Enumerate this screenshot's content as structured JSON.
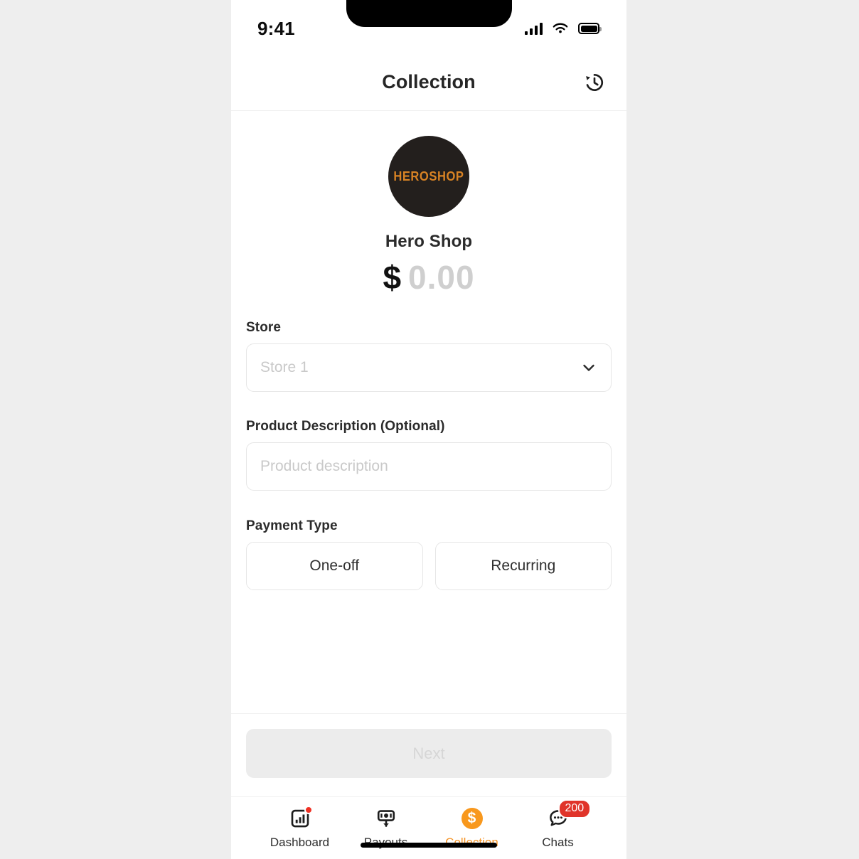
{
  "status_bar": {
    "time": "9:41",
    "icons": [
      "cellular-signal-icon",
      "wifi-icon",
      "battery-icon"
    ]
  },
  "header": {
    "title": "Collection",
    "history_icon": "history-icon"
  },
  "merchant": {
    "logo_text": "HEROSHOP",
    "name": "Hero Shop",
    "currency_symbol": "$",
    "amount_placeholder": "0.00"
  },
  "form": {
    "store": {
      "label": "Store",
      "placeholder": "Store 1",
      "value": "",
      "chevron_icon": "chevron-down-icon"
    },
    "description": {
      "label": "Product Description (Optional)",
      "placeholder": "Product description",
      "value": ""
    },
    "payment_type": {
      "label": "Payment Type",
      "options": [
        {
          "label": "One-off",
          "selected": false
        },
        {
          "label": "Recurring",
          "selected": false
        }
      ]
    }
  },
  "footer": {
    "next_label": "Next",
    "next_enabled": false
  },
  "tab_bar": {
    "items": [
      {
        "label": "Dashboard",
        "icon": "dashboard-chart-icon",
        "active": false,
        "badge_dot": true
      },
      {
        "label": "Payouts",
        "icon": "payout-download-icon",
        "active": false
      },
      {
        "label": "Collection",
        "icon": "dollar-coin-icon",
        "active": true
      },
      {
        "label": "Chats",
        "icon": "chat-bubble-icon",
        "active": false,
        "badge_count": "200"
      }
    ]
  },
  "colors": {
    "accent_orange": "#f59325",
    "coin_orange": "#f8981d",
    "logo_orange": "#d98324",
    "badge_red": "#e0342a",
    "dot_red": "#ef3124",
    "logo_bg": "#231f1d",
    "page_bg": "#eeeeee",
    "disabled_bg": "#ececec"
  }
}
